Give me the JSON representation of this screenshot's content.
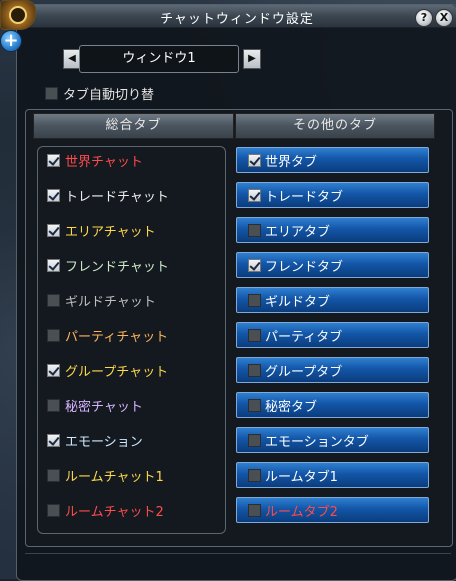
{
  "window": {
    "title": "チャットウィンドウ設定"
  },
  "titlebar_buttons": {
    "help_label": "?",
    "close_label": "X"
  },
  "window_selector": {
    "value": "ウィンドウ1",
    "prev_label": "◀",
    "next_label": "▶"
  },
  "auto_switch": {
    "label": "タブ自動切り替",
    "checked": false
  },
  "columns": {
    "left_header": "総合タブ",
    "right_header": "その他のタブ"
  },
  "general_tab_items": [
    {
      "label": "世界チャット",
      "checked": true,
      "color": "#ff4b4b"
    },
    {
      "label": "トレードチャット",
      "checked": true,
      "color": "#eeeeee"
    },
    {
      "label": "エリアチャット",
      "checked": true,
      "color": "#ffd84a"
    },
    {
      "label": "フレンドチャット",
      "checked": true,
      "color": "#cfe9c8"
    },
    {
      "label": "ギルドチャット",
      "checked": false,
      "color": "#bfbfbf"
    },
    {
      "label": "パーティチャット",
      "checked": false,
      "color": "#ffb45a"
    },
    {
      "label": "グループチャット",
      "checked": true,
      "color": "#ffd84a"
    },
    {
      "label": "秘密チャット",
      "checked": false,
      "color": "#d7b4ff"
    },
    {
      "label": "エモーション",
      "checked": true,
      "color": "#cfe7ff"
    },
    {
      "label": "ルームチャット1",
      "checked": false,
      "color": "#ffd84a"
    },
    {
      "label": "ルームチャット2",
      "checked": false,
      "color": "#ff4b4b"
    }
  ],
  "other_tab_items": [
    {
      "label": "世界タブ",
      "checked": true,
      "color": "#ffffff"
    },
    {
      "label": "トレードタブ",
      "checked": true,
      "color": "#ffffff"
    },
    {
      "label": "エリアタブ",
      "checked": false,
      "color": "#ffffff"
    },
    {
      "label": "フレンドタブ",
      "checked": true,
      "color": "#ffffff"
    },
    {
      "label": "ギルドタブ",
      "checked": false,
      "color": "#ffffff"
    },
    {
      "label": "パーティタブ",
      "checked": false,
      "color": "#ffffff"
    },
    {
      "label": "グループタブ",
      "checked": false,
      "color": "#ffffff"
    },
    {
      "label": "秘密タブ",
      "checked": false,
      "color": "#ffffff"
    },
    {
      "label": "エモーションタブ",
      "checked": false,
      "color": "#ffffff"
    },
    {
      "label": "ルームタブ1",
      "checked": false,
      "color": "#ffffff"
    },
    {
      "label": "ルームタブ2",
      "checked": false,
      "color": "#ff4b4b"
    }
  ]
}
